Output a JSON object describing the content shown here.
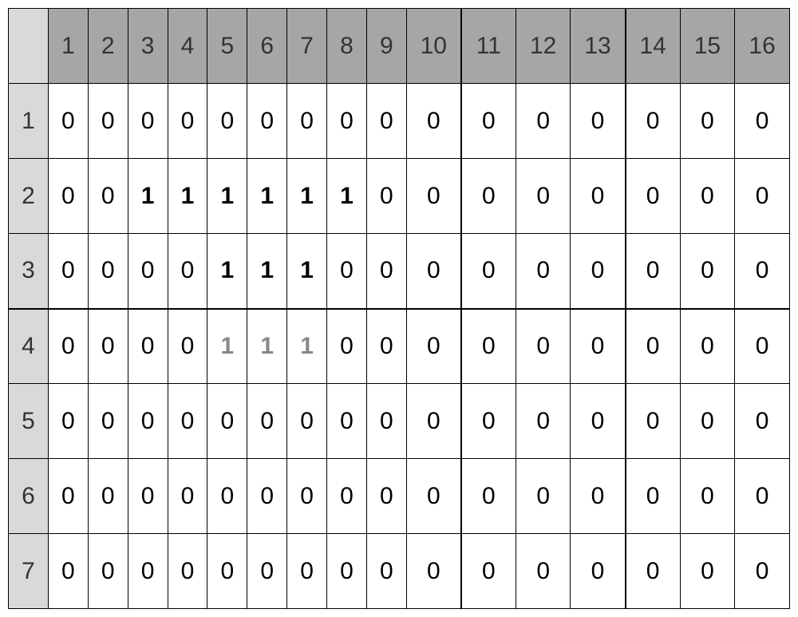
{
  "chart_data": {
    "type": "table",
    "col_headers": [
      "1",
      "2",
      "3",
      "4",
      "5",
      "6",
      "7",
      "8",
      "9",
      "10",
      "11",
      "12",
      "13",
      "14",
      "15",
      "16"
    ],
    "row_headers": [
      "1",
      "2",
      "3",
      "4",
      "5",
      "6",
      "7"
    ],
    "rows": [
      [
        "0",
        "0",
        "0",
        "0",
        "0",
        "0",
        "0",
        "0",
        "0",
        "0",
        "0",
        "0",
        "0",
        "0",
        "0",
        "0"
      ],
      [
        "0",
        "0",
        "1",
        "1",
        "1",
        "1",
        "1",
        "1",
        "0",
        "0",
        "0",
        "0",
        "0",
        "0",
        "0",
        "0"
      ],
      [
        "0",
        "0",
        "0",
        "0",
        "1",
        "1",
        "1",
        "0",
        "0",
        "0",
        "0",
        "0",
        "0",
        "0",
        "0",
        "0"
      ],
      [
        "0",
        "0",
        "0",
        "0",
        "1",
        "1",
        "1",
        "0",
        "0",
        "0",
        "0",
        "0",
        "0",
        "0",
        "0",
        "0"
      ],
      [
        "0",
        "0",
        "0",
        "0",
        "0",
        "0",
        "0",
        "0",
        "0",
        "0",
        "0",
        "0",
        "0",
        "0",
        "0",
        "0"
      ],
      [
        "0",
        "0",
        "0",
        "0",
        "0",
        "0",
        "0",
        "0",
        "0",
        "0",
        "0",
        "0",
        "0",
        "0",
        "0",
        "0"
      ],
      [
        "0",
        "0",
        "0",
        "0",
        "0",
        "0",
        "0",
        "0",
        "0",
        "0",
        "0",
        "0",
        "0",
        "0",
        "0",
        "0"
      ]
    ],
    "bold_cells": [
      [
        1,
        2
      ],
      [
        1,
        3
      ],
      [
        1,
        4
      ],
      [
        1,
        5
      ],
      [
        1,
        6
      ],
      [
        1,
        7
      ],
      [
        2,
        4
      ],
      [
        2,
        5
      ],
      [
        2,
        6
      ]
    ],
    "light_cells": [
      [
        3,
        4
      ],
      [
        3,
        5
      ],
      [
        3,
        6
      ]
    ],
    "thick_right_cols": [
      9,
      12
    ],
    "thick_bottom_rows": [
      2
    ]
  }
}
